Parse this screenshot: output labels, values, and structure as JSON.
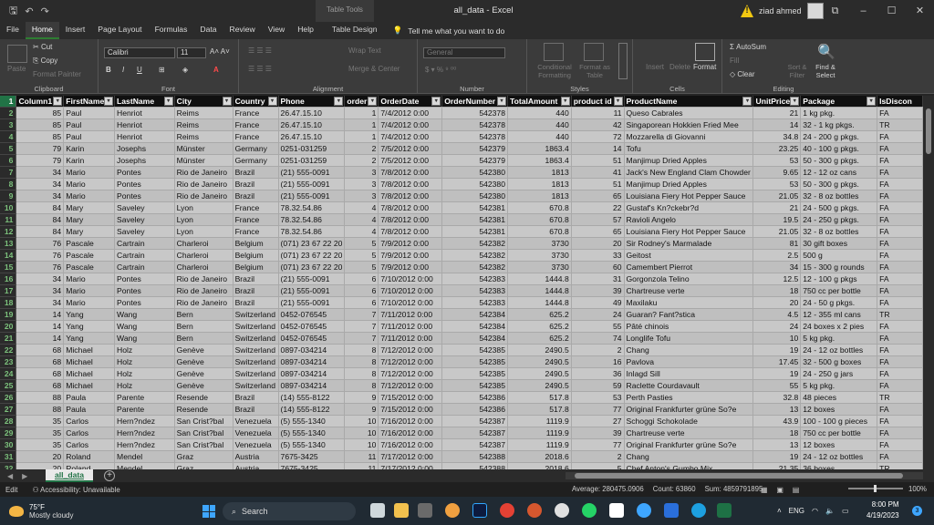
{
  "window": {
    "title": "all_data - Excel",
    "table_tools": "Table Tools",
    "user_name": "ziad ahmed"
  },
  "ribbon_tabs": [
    "File",
    "Home",
    "Insert",
    "Page Layout",
    "Formulas",
    "Data",
    "Review",
    "View",
    "Help"
  ],
  "design_tab": "Table Design",
  "tell_me": "Tell me what you want to do",
  "ribbon": {
    "clipboard": {
      "label": "Clipboard",
      "paste": "Paste",
      "cut": "Cut",
      "copy": "Copy",
      "format_painter": "Format Painter"
    },
    "font": {
      "label": "Font",
      "name": "Calibri",
      "size": "11"
    },
    "alignment": {
      "label": "Alignment",
      "wrap": "Wrap Text",
      "merge": "Merge & Center"
    },
    "number": {
      "label": "Number",
      "format": "General"
    },
    "styles": {
      "label": "Styles",
      "conditional": "Conditional Formatting",
      "format_table": "Format as Table"
    },
    "cells": {
      "label": "Cells",
      "insert": "Insert",
      "delete": "Delete",
      "format": "Format"
    },
    "editing": {
      "label": "Editing",
      "autosum": "AutoSum",
      "fill": "Fill",
      "clear": "Clear",
      "sort": "Sort & Filter",
      "find": "Find & Select"
    }
  },
  "table": {
    "headers": [
      "Column1",
      "FirstName",
      "LastName",
      "City",
      "Country",
      "Phone",
      "order id",
      "OrderDate",
      "OrderNumber",
      "TotalAmount",
      "product id",
      "ProductName",
      "UnitPrice",
      "Package",
      "IsDiscon"
    ],
    "rows": [
      [
        "85",
        "Paul",
        "Henriot",
        "Reims",
        "France",
        "26.47.15.10",
        "1",
        "7/4/2012 0:00",
        "542378",
        "440",
        "11",
        "Queso Cabrales",
        "21",
        "1 kg pkg.",
        "FA"
      ],
      [
        "85",
        "Paul",
        "Henriot",
        "Reims",
        "France",
        "26.47.15.10",
        "1",
        "7/4/2012 0:00",
        "542378",
        "440",
        "42",
        "Singaporean Hokkien Fried Mee",
        "14",
        "32 - 1 kg pkgs.",
        "TR"
      ],
      [
        "85",
        "Paul",
        "Henriot",
        "Reims",
        "France",
        "26.47.15.10",
        "1",
        "7/4/2012 0:00",
        "542378",
        "440",
        "72",
        "Mozzarella di Giovanni",
        "34.8",
        "24 - 200 g pkgs.",
        "FA"
      ],
      [
        "79",
        "Karin",
        "Josephs",
        "Münster",
        "Germany",
        "0251-031259",
        "2",
        "7/5/2012 0:00",
        "542379",
        "1863.4",
        "14",
        "Tofu",
        "23.25",
        "40 - 100 g pkgs.",
        "FA"
      ],
      [
        "79",
        "Karin",
        "Josephs",
        "Münster",
        "Germany",
        "0251-031259",
        "2",
        "7/5/2012 0:00",
        "542379",
        "1863.4",
        "51",
        "Manjimup Dried Apples",
        "53",
        "50 - 300 g pkgs.",
        "FA"
      ],
      [
        "34",
        "Mario",
        "Pontes",
        "Rio de Janeiro",
        "Brazil",
        "(21) 555-0091",
        "3",
        "7/8/2012 0:00",
        "542380",
        "1813",
        "41",
        "Jack's New England Clam Chowder",
        "9.65",
        "12 - 12 oz cans",
        "FA"
      ],
      [
        "34",
        "Mario",
        "Pontes",
        "Rio de Janeiro",
        "Brazil",
        "(21) 555-0091",
        "3",
        "7/8/2012 0:00",
        "542380",
        "1813",
        "51",
        "Manjimup Dried Apples",
        "53",
        "50 - 300 g pkgs.",
        "FA"
      ],
      [
        "34",
        "Mario",
        "Pontes",
        "Rio de Janeiro",
        "Brazil",
        "(21) 555-0091",
        "3",
        "7/8/2012 0:00",
        "542380",
        "1813",
        "65",
        "Louisiana Fiery Hot Pepper Sauce",
        "21.05",
        "32 - 8 oz bottles",
        "FA"
      ],
      [
        "84",
        "Mary",
        "Saveley",
        "Lyon",
        "France",
        "78.32.54.86",
        "4",
        "7/8/2012 0:00",
        "542381",
        "670.8",
        "22",
        "Gustaf's Kn?ckebr?d",
        "21",
        "24 - 500 g pkgs.",
        "FA"
      ],
      [
        "84",
        "Mary",
        "Saveley",
        "Lyon",
        "France",
        "78.32.54.86",
        "4",
        "7/8/2012 0:00",
        "542381",
        "670.8",
        "57",
        "Ravioli Angelo",
        "19.5",
        "24 - 250 g pkgs.",
        "FA"
      ],
      [
        "84",
        "Mary",
        "Saveley",
        "Lyon",
        "France",
        "78.32.54.86",
        "4",
        "7/8/2012 0:00",
        "542381",
        "670.8",
        "65",
        "Louisiana Fiery Hot Pepper Sauce",
        "21.05",
        "32 - 8 oz bottles",
        "FA"
      ],
      [
        "76",
        "Pascale",
        "Cartrain",
        "Charleroi",
        "Belgium",
        "(071) 23 67 22 20",
        "5",
        "7/9/2012 0:00",
        "542382",
        "3730",
        "20",
        "Sir Rodney's Marmalade",
        "81",
        "30 gift boxes",
        "FA"
      ],
      [
        "76",
        "Pascale",
        "Cartrain",
        "Charleroi",
        "Belgium",
        "(071) 23 67 22 20",
        "5",
        "7/9/2012 0:00",
        "542382",
        "3730",
        "33",
        "Geitost",
        "2.5",
        "500 g",
        "FA"
      ],
      [
        "76",
        "Pascale",
        "Cartrain",
        "Charleroi",
        "Belgium",
        "(071) 23 67 22 20",
        "5",
        "7/9/2012 0:00",
        "542382",
        "3730",
        "60",
        "Camembert Pierrot",
        "34",
        "15 - 300 g rounds",
        "FA"
      ],
      [
        "34",
        "Mario",
        "Pontes",
        "Rio de Janeiro",
        "Brazil",
        "(21) 555-0091",
        "6",
        "7/10/2012 0:00",
        "542383",
        "1444.8",
        "31",
        "Gorgonzola Telino",
        "12.5",
        "12 - 100 g pkgs",
        "FA"
      ],
      [
        "34",
        "Mario",
        "Pontes",
        "Rio de Janeiro",
        "Brazil",
        "(21) 555-0091",
        "6",
        "7/10/2012 0:00",
        "542383",
        "1444.8",
        "39",
        "Chartreuse verte",
        "18",
        "750 cc per bottle",
        "FA"
      ],
      [
        "34",
        "Mario",
        "Pontes",
        "Rio de Janeiro",
        "Brazil",
        "(21) 555-0091",
        "6",
        "7/10/2012 0:00",
        "542383",
        "1444.8",
        "49",
        "Maxilaku",
        "20",
        "24 - 50 g pkgs.",
        "FA"
      ],
      [
        "14",
        "Yang",
        "Wang",
        "Bern",
        "Switzerland",
        "0452-076545",
        "7",
        "7/11/2012 0:00",
        "542384",
        "625.2",
        "24",
        "Guaran? Fant?stica",
        "4.5",
        "12 - 355 ml cans",
        "TR"
      ],
      [
        "14",
        "Yang",
        "Wang",
        "Bern",
        "Switzerland",
        "0452-076545",
        "7",
        "7/11/2012 0:00",
        "542384",
        "625.2",
        "55",
        "Pâté chinois",
        "24",
        "24 boxes x 2 pies",
        "FA"
      ],
      [
        "14",
        "Yang",
        "Wang",
        "Bern",
        "Switzerland",
        "0452-076545",
        "7",
        "7/11/2012 0:00",
        "542384",
        "625.2",
        "74",
        "Longlife Tofu",
        "10",
        "5 kg pkg.",
        "FA"
      ],
      [
        "68",
        "Michael",
        "Holz",
        "Genève",
        "Switzerland",
        "0897-034214",
        "8",
        "7/12/2012 0:00",
        "542385",
        "2490.5",
        "2",
        "Chang",
        "19",
        "24 - 12 oz bottles",
        "FA"
      ],
      [
        "68",
        "Michael",
        "Holz",
        "Genève",
        "Switzerland",
        "0897-034214",
        "8",
        "7/12/2012 0:00",
        "542385",
        "2490.5",
        "16",
        "Pavlova",
        "17.45",
        "32 - 500 g boxes",
        "FA"
      ],
      [
        "68",
        "Michael",
        "Holz",
        "Genève",
        "Switzerland",
        "0897-034214",
        "8",
        "7/12/2012 0:00",
        "542385",
        "2490.5",
        "36",
        "Inlagd Sill",
        "19",
        "24 - 250 g  jars",
        "FA"
      ],
      [
        "68",
        "Michael",
        "Holz",
        "Genève",
        "Switzerland",
        "0897-034214",
        "8",
        "7/12/2012 0:00",
        "542385",
        "2490.5",
        "59",
        "Raclette Courdavault",
        "55",
        "5 kg pkg.",
        "FA"
      ],
      [
        "88",
        "Paula",
        "Parente",
        "Resende",
        "Brazil",
        "(14) 555-8122",
        "9",
        "7/15/2012 0:00",
        "542386",
        "517.8",
        "53",
        "Perth Pasties",
        "32.8",
        "48 pieces",
        "TR"
      ],
      [
        "88",
        "Paula",
        "Parente",
        "Resende",
        "Brazil",
        "(14) 555-8122",
        "9",
        "7/15/2012 0:00",
        "542386",
        "517.8",
        "77",
        "Original Frankfurter grüne So?e",
        "13",
        "12 boxes",
        "FA"
      ],
      [
        "35",
        "Carlos",
        "Hern?ndez",
        "San Crist?bal",
        "Venezuela",
        "(5) 555-1340",
        "10",
        "7/16/2012 0:00",
        "542387",
        "1119.9",
        "27",
        "Schoggi Schokolade",
        "43.9",
        "100 - 100 g pieces",
        "FA"
      ],
      [
        "35",
        "Carlos",
        "Hern?ndez",
        "San Crist?bal",
        "Venezuela",
        "(5) 555-1340",
        "10",
        "7/16/2012 0:00",
        "542387",
        "1119.9",
        "39",
        "Chartreuse verte",
        "18",
        "750 cc per bottle",
        "FA"
      ],
      [
        "35",
        "Carlos",
        "Hern?ndez",
        "San Crist?bal",
        "Venezuela",
        "(5) 555-1340",
        "10",
        "7/16/2012 0:00",
        "542387",
        "1119.9",
        "77",
        "Original Frankfurter grüne So?e",
        "13",
        "12 boxes",
        "FA"
      ],
      [
        "20",
        "Roland",
        "Mendel",
        "Graz",
        "Austria",
        "7675-3425",
        "11",
        "7/17/2012 0:00",
        "542388",
        "2018.6",
        "2",
        "Chang",
        "19",
        "24 - 12 oz bottles",
        "FA"
      ],
      [
        "20",
        "Roland",
        "Mendel",
        "Graz",
        "Austria",
        "7675-3425",
        "11",
        "7/17/2012 0:00",
        "542388",
        "2018.6",
        "5",
        "Chef Anton's Gumbo Mix",
        "21.35",
        "36 boxes",
        "TR"
      ]
    ]
  },
  "sheet_tab": "all_data",
  "status": {
    "mode": "Edit",
    "accessibility": "Accessibility: Unavailable",
    "average": "Average: 280475.0906",
    "count": "Count: 63860",
    "sum": "Sum: 4859791895",
    "zoom": "100%"
  },
  "taskbar": {
    "temp": "75°F",
    "weather": "Mostly cloudy",
    "search": "Search",
    "lang": "ENG",
    "time": "8:00 PM",
    "date": "4/19/2023",
    "notifications": "3"
  }
}
